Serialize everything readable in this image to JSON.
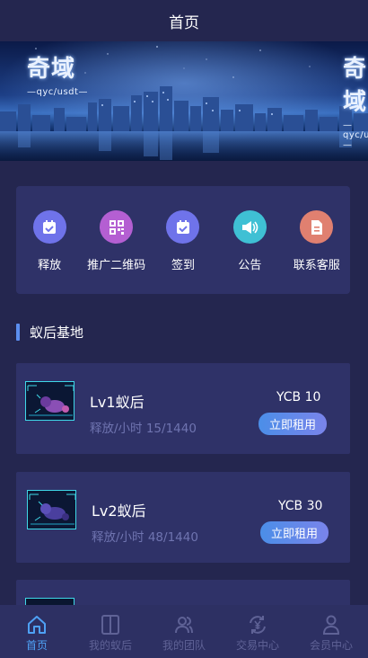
{
  "header": {
    "title": "首页"
  },
  "banner": {
    "brand_big": "奇域",
    "brand_small": "—qyc/usdt—"
  },
  "quick_actions": [
    {
      "label": "释放",
      "icon": "calendar-icon",
      "color": "#6f73ea"
    },
    {
      "label": "推广二维码",
      "icon": "qrcode-icon",
      "color": "#b45fd2"
    },
    {
      "label": "签到",
      "icon": "calendar-check-icon",
      "color": "#6f73ea"
    },
    {
      "label": "公告",
      "icon": "speaker-icon",
      "color": "#3fc0d4"
    },
    {
      "label": "联系客服",
      "icon": "document-icon",
      "color": "#e08070"
    }
  ],
  "section": {
    "title": "蚁后基地"
  },
  "cards": [
    {
      "level": "Lv1蚁后",
      "rate": "释放/小时 15/1440",
      "price": "YCB 10",
      "button": "立即租用"
    },
    {
      "level": "Lv2蚁后",
      "rate": "释放/小时 48/1440",
      "price": "YCB 30",
      "button": "立即租用"
    },
    {
      "level": "",
      "rate": "",
      "price": "",
      "button": ""
    }
  ],
  "tabbar": [
    {
      "label": "首页",
      "icon": "home-icon",
      "active": true
    },
    {
      "label": "我的蚁后",
      "icon": "book-icon",
      "active": false
    },
    {
      "label": "我的团队",
      "icon": "team-icon",
      "active": false
    },
    {
      "label": "交易中心",
      "icon": "exchange-icon",
      "active": false
    },
    {
      "label": "会员中心",
      "icon": "user-icon",
      "active": false
    }
  ],
  "colors": {
    "background": "#24264f",
    "card": "#2f3268",
    "accent": "#4ea1f5"
  }
}
